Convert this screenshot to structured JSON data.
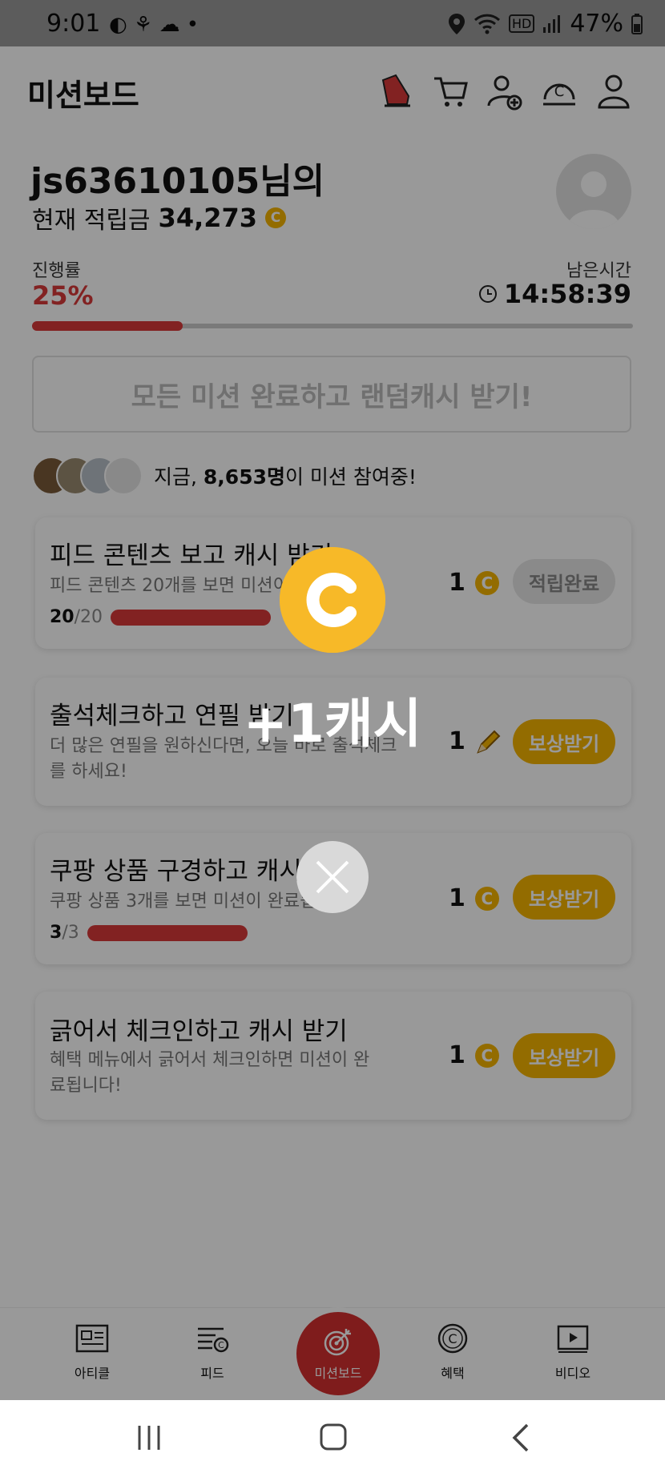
{
  "status_bar": {
    "time": "9:01",
    "battery": "47%",
    "hd_label": "HD"
  },
  "header": {
    "title": "미션보드"
  },
  "user": {
    "name": "js63610105님의",
    "points_label": "현재 적립금",
    "points_value": "34,273",
    "coin_symbol": "C"
  },
  "progress": {
    "label": "진행률",
    "percent_text": "25%",
    "fraction": 0.25,
    "remaining_label": "남은시간",
    "remaining_time": "14:58:39"
  },
  "all_missions_button": "모든 미션 완료하고 랜덤캐시 받기!",
  "participants": {
    "prefix": "지금,",
    "count": "8,653명",
    "suffix": "이 미션 참여중!"
  },
  "missions": [
    {
      "title": "피드 콘텐츠 보고 캐시 받기",
      "desc": "피드 콘텐츠 20개를 보면 미션이",
      "progress_done": "20",
      "progress_total": "/20",
      "reward": "1",
      "button": "적립완료"
    },
    {
      "title": "출석체크하고 연필 받기",
      "desc": "더 많은 연필을 원하신다면, 오늘 바로 출석체크를 하세요!",
      "reward": "1",
      "button": "보상받기"
    },
    {
      "title": "쿠팡 상품 구경하고 캐시 받기",
      "desc": "쿠팡 상품 3개를 보면 미션이 완료됩",
      "progress_done": "3",
      "progress_total": "/3",
      "reward": "1",
      "button": "보상받기"
    },
    {
      "title": "긁어서 체크인하고 캐시 받기",
      "desc": "혜택 메뉴에서 긁어서 체크인하면 미션이 완료됩니다!",
      "reward": "1",
      "button": "보상받기"
    }
  ],
  "bottom_nav": {
    "article": "아티클",
    "feed": "피드",
    "missionboard": "미션보드",
    "benefit": "혜택",
    "video": "비디오"
  },
  "popup": {
    "coin_symbol": "C",
    "message": "+1캐시"
  },
  "colors": {
    "accent_red": "#d93a3a",
    "coin_yellow": "#f5b400"
  }
}
